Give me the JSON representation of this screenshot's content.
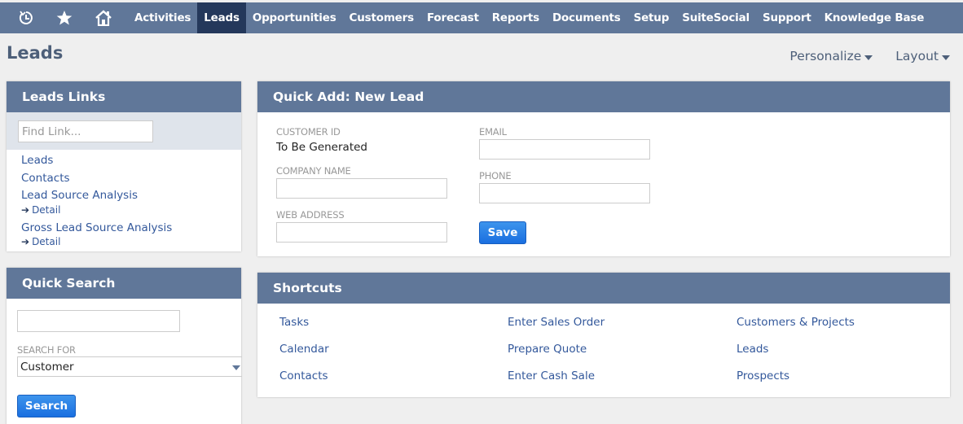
{
  "nav": {
    "icons": [
      {
        "name": "recent-history-icon",
        "glyph": "↻"
      },
      {
        "name": "star-icon",
        "glyph": "★"
      },
      {
        "name": "home-icon",
        "glyph": "⌂"
      }
    ],
    "items": [
      {
        "label": "Activities",
        "active": false
      },
      {
        "label": "Leads",
        "active": true
      },
      {
        "label": "Opportunities",
        "active": false
      },
      {
        "label": "Customers",
        "active": false
      },
      {
        "label": "Forecast",
        "active": false
      },
      {
        "label": "Reports",
        "active": false
      },
      {
        "label": "Documents",
        "active": false
      },
      {
        "label": "Setup",
        "active": false
      },
      {
        "label": "SuiteSocial",
        "active": false
      },
      {
        "label": "Support",
        "active": false
      },
      {
        "label": "Knowledge Base",
        "active": false
      }
    ],
    "colors": {
      "bar": "#607799",
      "active": "#24385b"
    }
  },
  "page": {
    "title": "Leads",
    "personalize_label": "Personalize",
    "layout_label": "Layout"
  },
  "leads_links": {
    "title": "Leads Links",
    "find_placeholder": "Find Link...",
    "links": [
      {
        "label": "Leads"
      },
      {
        "label": "Contacts"
      },
      {
        "label": "Lead Source Analysis",
        "detail": "Detail"
      },
      {
        "label": "Gross Lead Source Analysis",
        "detail": "Detail"
      }
    ]
  },
  "quick_search": {
    "title": "Quick Search",
    "input_value": "",
    "search_for_label": "SEARCH FOR",
    "search_for_value": "Customer",
    "button_label": "Search"
  },
  "quick_add": {
    "title": "Quick Add: New Lead",
    "customer_id_label": "CUSTOMER ID",
    "customer_id_value": "To Be Generated",
    "company_name_label": "COMPANY NAME",
    "company_name_value": "",
    "web_address_label": "WEB ADDRESS",
    "web_address_value": "",
    "email_label": "EMAIL",
    "email_value": "",
    "phone_label": "PHONE",
    "phone_value": "",
    "save_label": "Save"
  },
  "shortcuts": {
    "title": "Shortcuts",
    "columns": [
      [
        "Tasks",
        "Calendar",
        "Contacts"
      ],
      [
        "Enter Sales Order",
        "Prepare Quote",
        "Enter Cash Sale"
      ],
      [
        "Customers & Projects",
        "Leads",
        "Prospects"
      ]
    ]
  }
}
